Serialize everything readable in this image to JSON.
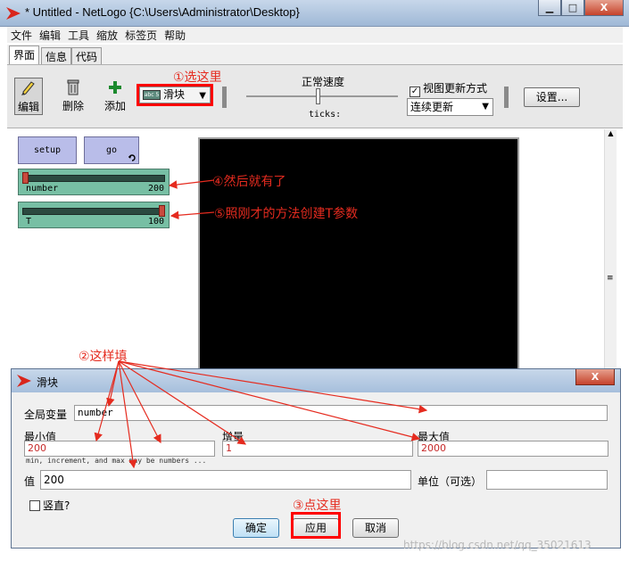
{
  "window": {
    "title": "* Untitled - NetLogo {C:\\Users\\Administrator\\Desktop}",
    "min_glyph": "▁",
    "max_glyph": "□",
    "close_glyph": "X"
  },
  "menu": [
    "文件",
    "编辑",
    "工具",
    "缩放",
    "标签页",
    "帮助"
  ],
  "tabs": [
    "界面",
    "信息",
    "代码"
  ],
  "toolbar": {
    "edit_label": "编辑",
    "delete_label": "删除",
    "add_label": "添加",
    "widget_type": "滑块",
    "widget_icon_text": "abc 5",
    "speed_label": "正常速度",
    "ticks_label": "ticks:",
    "view_update_label": "视图更新方式",
    "view_update_mode": "连续更新",
    "settings_label": "设置..."
  },
  "widgets": {
    "setup_label": "setup",
    "go_label": "go",
    "sliders": [
      {
        "name": "number",
        "value": "200",
        "fraction": 0.0
      },
      {
        "name": "T",
        "value": "100",
        "fraction": 1.0
      }
    ]
  },
  "dialog": {
    "title": "滑块",
    "global_var_label": "全局变量",
    "global_var_value": "number",
    "min_label": "最小值",
    "min_value": "200",
    "inc_label": "增量",
    "inc_value": "1",
    "max_label": "最大值",
    "max_value": "2000",
    "hint": "min, increment, and max may be numbers ...",
    "value_label": "值",
    "value_value": "200",
    "units_label": "单位（可选）",
    "units_value": "",
    "vertical_label": "竖直?",
    "ok_label": "确定",
    "apply_label": "应用",
    "cancel_label": "取消"
  },
  "annotations": {
    "step1": "①选这里",
    "step2": "②这样填",
    "step3": "③点这里",
    "step4": "④然后就有了",
    "step5": "⑤照刚才的方法创建T参数"
  },
  "watermark": "https://blog.csdn.net/qq_35021613",
  "colors": {
    "annotation": "#e52b1f",
    "slider": "#77bfa4",
    "button": "#b9bde9",
    "view": "#000000"
  }
}
